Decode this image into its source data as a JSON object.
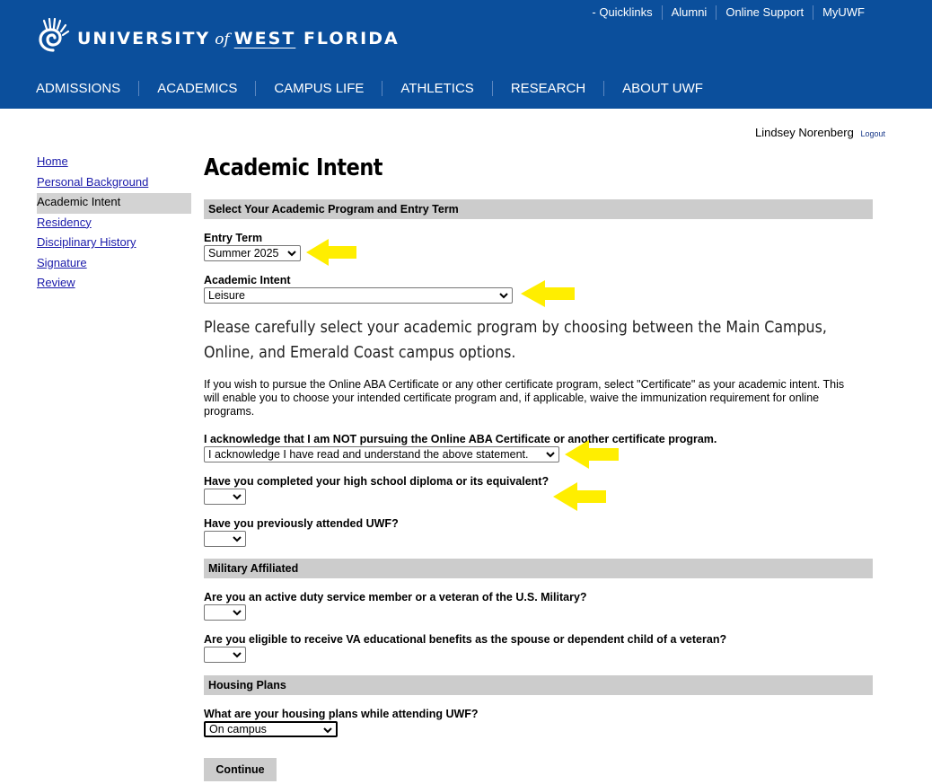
{
  "header": {
    "logo": {
      "university": "UNIVERSITY",
      "of": "of",
      "west": "WEST",
      "florida": "FLORIDA"
    },
    "quicklinks": [
      "- Quicklinks",
      "Alumni",
      "Online Support",
      "MyUWF"
    ],
    "nav": [
      "ADMISSIONS",
      "ACADEMICS",
      "CAMPUS LIFE",
      "ATHLETICS",
      "RESEARCH",
      "ABOUT UWF"
    ],
    "colors": {
      "brand": "#0b4f9c"
    }
  },
  "user": {
    "name": "Lindsey Norenberg",
    "logout": "Logout"
  },
  "sidebar": {
    "items": [
      {
        "label": "Home",
        "active": false
      },
      {
        "label": "Personal Background",
        "active": false
      },
      {
        "label": "Academic Intent",
        "active": true
      },
      {
        "label": "Residency",
        "active": false
      },
      {
        "label": "Disciplinary History",
        "active": false
      },
      {
        "label": "Signature",
        "active": false
      },
      {
        "label": "Review",
        "active": false
      }
    ]
  },
  "main": {
    "title": "Academic Intent",
    "sections": {
      "program": "Select Your Academic Program and Entry Term",
      "military": "Military Affiliated",
      "housing": "Housing Plans"
    },
    "entry_term": {
      "label": "Entry Term",
      "value": "Summer 2025"
    },
    "academic_intent": {
      "label": "Academic Intent",
      "value": "Leisure"
    },
    "lead_text": "Please carefully select your academic program by choosing between the Main Campus, Online, and Emerald Coast campus options.",
    "info_text": "If you wish to pursue the Online ABA Certificate or any other certificate program, select \"Certificate\" as your academic intent. This will enable you to choose your intended certificate program and, if applicable, waive the immunization requirement for online programs.",
    "acknowledge": {
      "label": "I acknowledge that I am NOT pursuing the Online ABA Certificate or another certificate program.",
      "value": "I acknowledge I have read and understand the above statement."
    },
    "high_school": {
      "label": "Have you completed your high school diploma or its equivalent?",
      "value": ""
    },
    "attended_uwf": {
      "label": "Have you previously attended UWF?",
      "value": ""
    },
    "active_duty": {
      "label": "Are you an active duty service member or a veteran of the U.S. Military?",
      "value": ""
    },
    "va_benefits": {
      "label": "Are you eligible to receive VA educational benefits as the spouse or dependent child of a veteran?",
      "value": ""
    },
    "housing_plans": {
      "label": "What are your housing plans while attending UWF?",
      "value": "On campus"
    },
    "continue_label": "Continue",
    "annotation_color": "#ffee00"
  }
}
